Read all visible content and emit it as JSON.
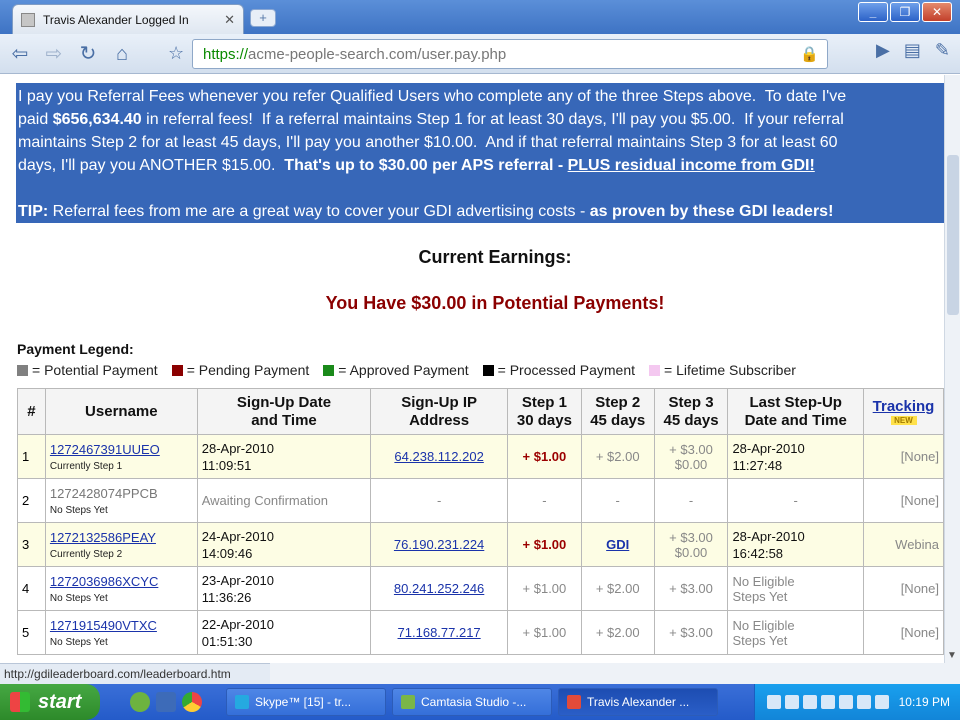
{
  "browser": {
    "tab_title": "Travis Alexander Logged In",
    "tab_close": "✕",
    "new_tab": "+",
    "window_buttons": [
      "_",
      "❐",
      "✕"
    ],
    "url_https": "https://",
    "url_rest": "acme-people-search.com/user.pay.php",
    "url_lock": "🔒"
  },
  "selected_text": {
    "line1": "I pay you Referral Fees whenever you refer Qualified Users who complete any of the three Steps above.  To date I've",
    "line2_pre": "paid ",
    "line2_amount": "$656,634.40",
    "line2_post": " in referral fees!  If a referral maintains Step 1 for at least 30 days, I'll pay you $5.00.  If your referral",
    "line3": "maintains Step 2 for at least 45 days, I'll pay you another $10.00.  And if that referral maintains Step 3 for at least 60",
    "line4_pre": "days, I'll pay you ANOTHER $15.00.  ",
    "line4_bold": "That's up to $30.00 per APS referral - ",
    "line4_ul": "PLUS residual income from GDI!",
    "tip_label": "TIP:",
    "tip_text": " Referral fees from me are a great way to cover your GDI advertising costs - ",
    "tip_bold": "as proven by these GDI leaders!"
  },
  "earnings": {
    "title": "Current Earnings:",
    "potential": "You Have $30.00 in Potential Payments!"
  },
  "legend": {
    "title": "Payment Legend:",
    "items": [
      {
        "label": "= Potential Payment",
        "color": "#808080"
      },
      {
        "label": "= Pending Payment",
        "color": "#8b0000"
      },
      {
        "label": "= Approved Payment",
        "color": "#1a8a1a"
      },
      {
        "label": "= Processed Payment",
        "color": "#000000"
      },
      {
        "label": "= Lifetime Subscriber",
        "color": "#f4c8f0"
      }
    ]
  },
  "table": {
    "headers": {
      "num": "#",
      "username": "Username",
      "signup_a": "Sign-Up Date",
      "signup_b": "and Time",
      "ip_a": "Sign-Up IP",
      "ip_b": "Address",
      "s1_a": "Step 1",
      "s1_b": "30 days",
      "s2_a": "Step 2",
      "s2_b": "45 days",
      "s3_a": "Step 3",
      "s3_b": "45 days",
      "last_a": "Last Step-Up",
      "last_b": "Date and Time",
      "tracking": "Tracking",
      "new_badge": "NEW"
    },
    "rows": [
      {
        "num": "1",
        "user": "1272467391UUEO",
        "status": "Currently Step 1",
        "d1": "28-Apr-2010",
        "d2": "11:09:51",
        "ip": "64.238.112.202",
        "s1": "+ $1.00",
        "s2": "+ $2.00",
        "s3a": "+ $3.00",
        "s3b": "$0.00",
        "l1": "28-Apr-2010",
        "l2": "11:27:48",
        "track": "[None]"
      },
      {
        "num": "2",
        "user": "1272428074PPCB",
        "status": "No Steps Yet",
        "d1": "Awaiting Confirmation",
        "ip": "-",
        "s1": "-",
        "s2": "-",
        "s3": "-",
        "l1": "-",
        "track": "[None]"
      },
      {
        "num": "3",
        "user": "1272132586PEAY",
        "status": "Currently Step 2",
        "d1": "24-Apr-2010",
        "d2": "14:09:46",
        "ip": "76.190.231.224",
        "s1": "+ $1.00",
        "s2": "GDI",
        "s3a": "+ $3.00",
        "s3b": "$0.00",
        "l1": "28-Apr-2010",
        "l2": "16:42:58",
        "track": "Webina"
      },
      {
        "num": "4",
        "user": "1272036986XCYC",
        "status": "No Steps Yet",
        "d1": "23-Apr-2010",
        "d2": "11:36:26",
        "ip": "80.241.252.246",
        "s1": "+ $1.00",
        "s2": "+ $2.00",
        "s3": "+ $3.00",
        "l1": "No Eligible",
        "l2": "Steps Yet",
        "track": "[None]"
      },
      {
        "num": "5",
        "user": "1271915490VTXC",
        "status": "No Steps Yet",
        "d1": "22-Apr-2010",
        "d2": "01:51:30",
        "ip": "71.168.77.217",
        "s1": "+ $1.00",
        "s2": "+ $2.00",
        "s3": "+ $3.00",
        "l1": "No Eligible",
        "l2": "Steps Yet",
        "track": "[None]"
      }
    ]
  },
  "status_bar": "http://gdileaderboard.com/leaderboard.htm",
  "taskbar": {
    "start": "start",
    "items": [
      {
        "label": "Skype™ [15] - tr...",
        "color": "#25a9e0"
      },
      {
        "label": "Camtasia Studio -...",
        "color": "#7ab648"
      },
      {
        "label": "Travis Alexander ...",
        "color": "#e24b3a"
      }
    ],
    "clock": "10:19 PM"
  }
}
